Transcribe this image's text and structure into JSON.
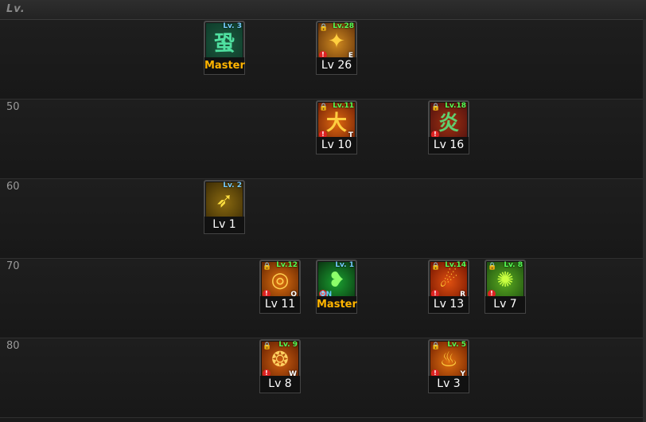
{
  "header": {
    "label": "Lv."
  },
  "rows": [
    {
      "label": ""
    },
    {
      "label": "50"
    },
    {
      "label": "60"
    },
    {
      "label": "70"
    },
    {
      "label": "80"
    }
  ],
  "skills": [
    {
      "name": "skill-1",
      "level_badge": "Lv. 3",
      "caption": "Master",
      "glyph": "蛩",
      "key": "",
      "locked": false,
      "warn": false,
      "on": "",
      "colors": [
        "#0e3a2a",
        "#1c5a3e"
      ],
      "glyph_color": "#4fe0a0"
    },
    {
      "name": "skill-2",
      "level_badge": "Lv.28",
      "caption": "Lv 26",
      "glyph": "✦",
      "key": "E",
      "locked": true,
      "warn": true,
      "on": "",
      "colors": [
        "#5a2a08",
        "#d08a20"
      ],
      "glyph_color": "#ffd040"
    },
    {
      "name": "skill-3",
      "level_badge": "Lv.11",
      "caption": "Lv 10",
      "glyph": "大",
      "key": "T",
      "locked": true,
      "warn": true,
      "on": "",
      "colors": [
        "#6a1a05",
        "#e06a10"
      ],
      "glyph_color": "#ffcf40"
    },
    {
      "name": "skill-4",
      "level_badge": "Lv.18",
      "caption": "Lv 16",
      "glyph": "炎",
      "key": "",
      "locked": true,
      "warn": true,
      "on": "",
      "colors": [
        "#4a1010",
        "#a03010"
      ],
      "glyph_color": "#5fd070"
    },
    {
      "name": "skill-5",
      "level_badge": "Lv. 2",
      "caption": "Lv 1",
      "glyph": "➶",
      "key": "",
      "locked": false,
      "warn": false,
      "on": "",
      "colors": [
        "#3a2a05",
        "#8a6a10"
      ],
      "glyph_color": "#ffe040"
    },
    {
      "name": "skill-6",
      "level_badge": "Lv.12",
      "caption": "Lv 11",
      "glyph": "◎",
      "key": "Q",
      "locked": true,
      "warn": true,
      "on": "",
      "colors": [
        "#5a2000",
        "#e07010"
      ],
      "glyph_color": "#ffd050"
    },
    {
      "name": "skill-7",
      "level_badge": "Lv. 1",
      "caption": "Master",
      "glyph": "❥",
      "key": "",
      "locked": false,
      "warn": true,
      "on": "ON",
      "colors": [
        "#0a3010",
        "#1aa030"
      ],
      "glyph_color": "#8cff6a"
    },
    {
      "name": "skill-8",
      "level_badge": "Lv.14",
      "caption": "Lv 13",
      "glyph": "☄",
      "key": "R",
      "locked": true,
      "warn": true,
      "on": "",
      "colors": [
        "#6a1000",
        "#e05010"
      ],
      "glyph_color": "#ffc030"
    },
    {
      "name": "skill-9",
      "level_badge": "Lv. 8",
      "caption": "Lv 7",
      "glyph": "✺",
      "key": "",
      "locked": true,
      "warn": true,
      "on": "",
      "colors": [
        "#1a4a10",
        "#5aaa20"
      ],
      "glyph_color": "#c8ff40"
    },
    {
      "name": "skill-10",
      "level_badge": "Lv. 9",
      "caption": "Lv 8",
      "glyph": "❂",
      "key": "W",
      "locked": true,
      "warn": true,
      "on": "",
      "colors": [
        "#5a1a00",
        "#d06010"
      ],
      "glyph_color": "#ffd060"
    },
    {
      "name": "skill-11",
      "level_badge": "Lv. 5",
      "caption": "Lv 3",
      "glyph": "♨",
      "key": "Y",
      "locked": true,
      "warn": true,
      "on": "",
      "colors": [
        "#6a1a00",
        "#e07010"
      ],
      "glyph_color": "#ffd040"
    }
  ]
}
